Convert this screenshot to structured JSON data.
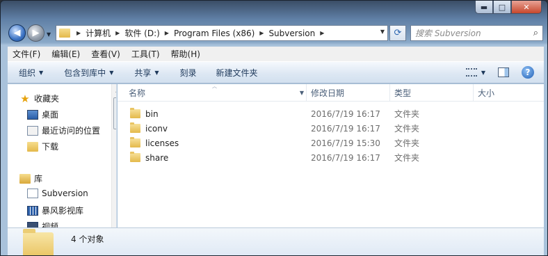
{
  "window": {
    "controls": {
      "minimize": "▬",
      "maximize": "□",
      "close": "✕"
    }
  },
  "nav": {
    "back_icon": "◀",
    "forward_icon": "▶",
    "recent_dropdown": "▼"
  },
  "address": {
    "crumbs": [
      "计算机",
      "软件 (D:)",
      "Program Files (x86)",
      "Subversion"
    ],
    "separator": "▶",
    "dropdown": "▼",
    "refresh_icon": "⟳"
  },
  "search": {
    "placeholder": "搜索 Subversion",
    "icon": "⌕"
  },
  "menu": {
    "file": "文件(F)",
    "edit": "编辑(E)",
    "view": "查看(V)",
    "tools": "工具(T)",
    "help": "帮助(H)"
  },
  "commands": {
    "organize": "组织",
    "include_in_library": "包含到库中",
    "share": "共享",
    "burn": "刻录",
    "new_folder": "新建文件夹",
    "caret": "▼",
    "help_icon": "?"
  },
  "navpane": {
    "favorites": "收藏夹",
    "desktop": "桌面",
    "recent": "最近访问的位置",
    "downloads": "下载",
    "libraries": "库",
    "lib_subversion": "Subversion",
    "lib_baofeng": "暴风影视库",
    "lib_video": "视频",
    "scroll_up": "▲"
  },
  "columns": {
    "name": "名称",
    "modified": "修改日期",
    "type": "类型",
    "size": "大小",
    "sort_indicator": "︿",
    "dropdown": "▼"
  },
  "files": [
    {
      "name": "bin",
      "modified": "2016/7/19 16:17",
      "type": "文件夹"
    },
    {
      "name": "iconv",
      "modified": "2016/7/19 16:17",
      "type": "文件夹"
    },
    {
      "name": "licenses",
      "modified": "2016/7/19 15:30",
      "type": "文件夹"
    },
    {
      "name": "share",
      "modified": "2016/7/19 16:17",
      "type": "文件夹"
    }
  ],
  "details": {
    "count": "4 个对象"
  }
}
